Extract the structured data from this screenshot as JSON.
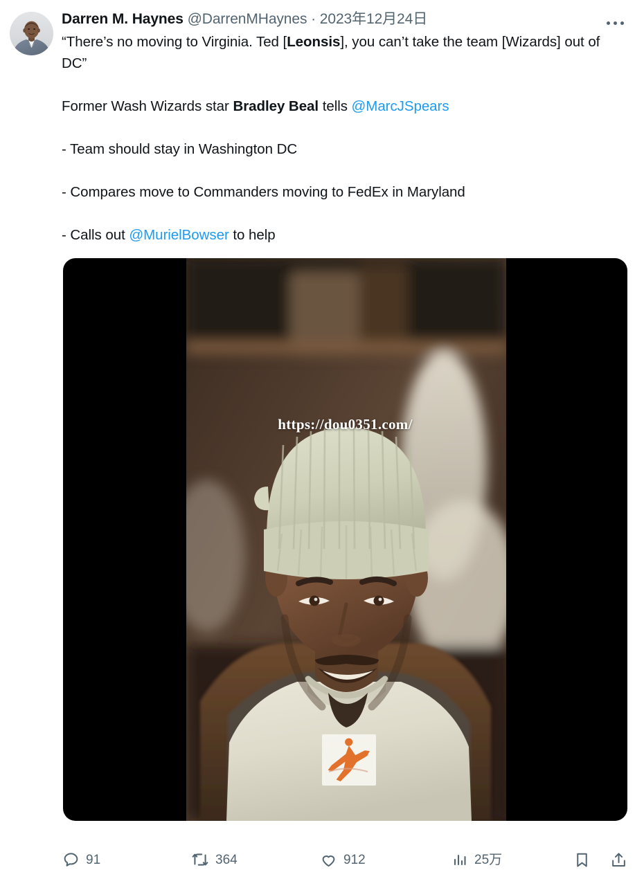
{
  "post": {
    "author": {
      "display_name": "Darren M. Haynes",
      "handle": "@DarrenMHaynes",
      "separator": "·",
      "date": "2023年12月24日",
      "avatar_icon": "user-avatar-photo"
    },
    "more_icon": "more-horizontal-icon",
    "body": {
      "line1_a": "“There’s no moving to Virginia. Ted [",
      "line1_bold": "Leonsis",
      "line1_b": "], you can’t take the team [Wizards] out of DC”",
      "line2_a": "Former Wash Wizards star ",
      "line2_bold": "Bradley Beal",
      "line2_b": " tells ",
      "line2_mention": "@MarcJSpears",
      "line3": "- Team should stay in Washington DC",
      "line4": "- Compares move to Commanders moving to FedEx in Maryland",
      "line5_a": "- Calls out ",
      "line5_mention": "@MurielBowser",
      "line5_b": " to help"
    },
    "media": {
      "type": "video",
      "watermark": "https://dou0351.com/",
      "letterbox_color": "#000000",
      "description": "Man wearing a light sage green knit beanie and cream crewneck sweatshirt with an orange Jumpman logo patch, smiling indoors"
    },
    "actions": {
      "reply": {
        "icon": "reply-icon",
        "count": "91"
      },
      "retweet": {
        "icon": "retweet-icon",
        "count": "364"
      },
      "like": {
        "icon": "heart-icon",
        "count": "912"
      },
      "views": {
        "icon": "analytics-bar-icon",
        "count": "25万"
      },
      "bookmark": {
        "icon": "bookmark-icon"
      },
      "share": {
        "icon": "share-upload-icon"
      }
    }
  },
  "colors": {
    "text": "#0f1419",
    "muted": "#536471",
    "link": "#1d9bf0",
    "background": "#ffffff",
    "media_background": "#000000"
  }
}
